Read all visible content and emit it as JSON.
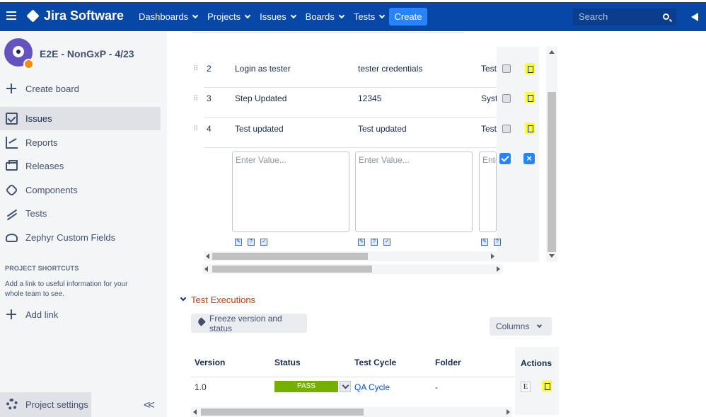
{
  "topbar": {
    "logo": "Jira Software",
    "nav": [
      "Dashboards",
      "Projects",
      "Issues",
      "Boards",
      "Tests"
    ],
    "create": "Create",
    "search_placeholder": "Search"
  },
  "sidebar": {
    "project_name": "E2E - NonGxP - 4/23",
    "create_board": "Create board",
    "items": [
      "Issues",
      "Reports",
      "Releases",
      "Components",
      "Tests",
      "Zephyr Custom Fields"
    ],
    "shortcuts_title": "PROJECT SHORTCUTS",
    "shortcuts_text": "Add a link to useful information for your whole team to see.",
    "add_link": "Add link",
    "project_settings": "Project settings"
  },
  "steps": [
    {
      "num": "2",
      "step": "Login as tester",
      "data": "tester credentials",
      "result": "Test"
    },
    {
      "num": "3",
      "step": "Step Updated",
      "data": "12345",
      "result": "Syst"
    },
    {
      "num": "4",
      "step": "Test updated",
      "data": "Test updated",
      "result": "Test"
    }
  ],
  "new_step": {
    "step_placeholder": "Enter Value...",
    "data_placeholder": "Enter Value...",
    "result_placeholder": "Enter Value..."
  },
  "executions": {
    "title": "Test Executions",
    "freeze_button": "Freeze version and status",
    "columns_button": "Columns",
    "headers": {
      "version": "Version",
      "status": "Status",
      "cycle": "Test Cycle",
      "folder": "Folder",
      "actions": "Actions"
    },
    "rows": [
      {
        "version": "1.0",
        "status": "PASS",
        "cycle": "QA Cycle",
        "folder": "-",
        "action": "E"
      }
    ],
    "status_color": "#75b000"
  },
  "colors": {
    "topbar": "#0747a6",
    "create": "#2684ff",
    "highlight": "#ffff3a",
    "section_title": "#de350b"
  }
}
